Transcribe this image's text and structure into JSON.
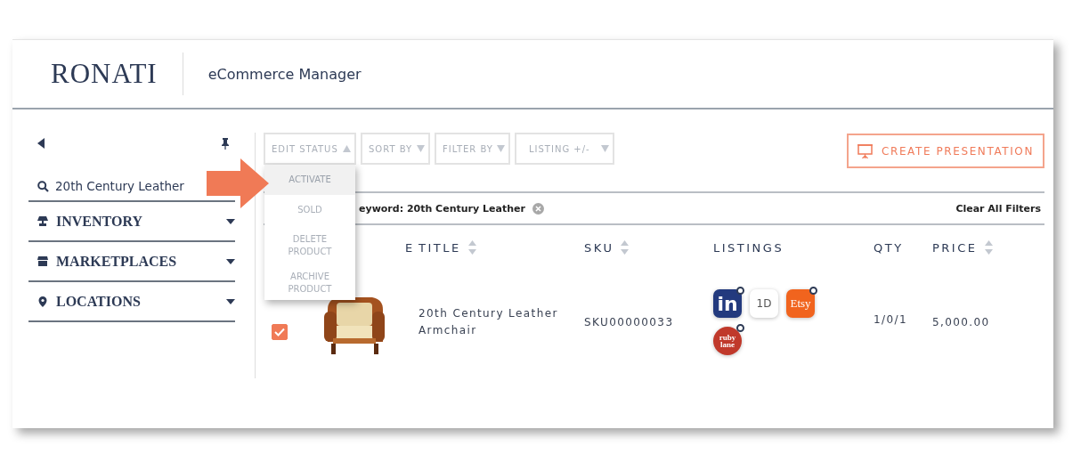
{
  "header": {
    "logo": "RONATI",
    "app_title": "eCommerce Manager"
  },
  "sidebar": {
    "search": {
      "value": "20th Century Leather"
    },
    "items": [
      {
        "kind": "inventory",
        "label": "INVENTORY",
        "expanded": false
      },
      {
        "kind": "marketplaces",
        "label": "MARKETPLACES",
        "expanded": false
      },
      {
        "kind": "locations",
        "label": "LOCATIONS",
        "expanded": false
      }
    ]
  },
  "toolbar": {
    "buttons": [
      {
        "label": "EDIT STATUS",
        "expanded": true
      },
      {
        "label": "SORT BY",
        "expanded": false
      },
      {
        "label": "FILTER BY",
        "expanded": false
      },
      {
        "label": "LISTING +/-",
        "expanded": false
      }
    ],
    "create_button": "CREATE PRESENTATION"
  },
  "status_menu": {
    "items": [
      {
        "label": "ACTIVATE",
        "selected": true
      },
      {
        "label": "SOLD",
        "selected": false
      },
      {
        "label": "DELETE PRODUCT",
        "selected": false
      },
      {
        "label": "ARCHIVE PRODUCT",
        "selected": false
      }
    ]
  },
  "filters": {
    "chip": "eyword: 20th Century Leather",
    "clear": "Clear All Filters"
  },
  "table": {
    "columns": [
      {
        "label": "E",
        "sortable": false
      },
      {
        "label": "TITLE",
        "sortable": true
      },
      {
        "label": "SKU",
        "sortable": true
      },
      {
        "label": "LISTINGS",
        "sortable": false
      },
      {
        "label": "QTY",
        "sortable": false
      },
      {
        "label": "PRICE",
        "sortable": true
      }
    ],
    "rows": [
      {
        "checked": true,
        "title": "20th Century Leather Armchair",
        "sku": "SKU00000033",
        "listings": [
          {
            "kind": "invaluable",
            "label": "in",
            "linked": true
          },
          {
            "kind": "firstdibs",
            "label": "1D",
            "linked": false
          },
          {
            "kind": "etsy",
            "label": "Etsy",
            "linked": true
          },
          {
            "kind": "rubylane",
            "label": "ruby lane",
            "linked": true
          }
        ],
        "qty": "1/0/1",
        "price": "5,000.00"
      }
    ]
  }
}
